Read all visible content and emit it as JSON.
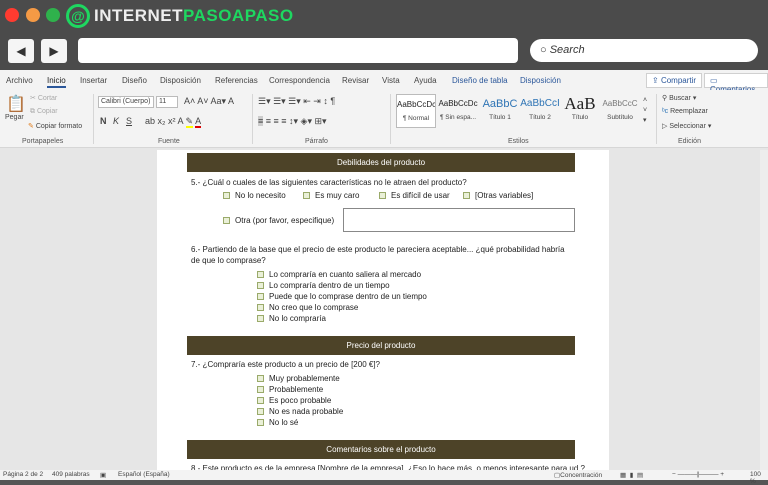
{
  "browser": {
    "logo_left": "INTERNET",
    "logo_right": "PASOAPASO",
    "lights": [
      "#ff3b30",
      "#f59a45",
      "#2fb24c"
    ],
    "back_icon": "◀",
    "forward_icon": "▶",
    "address_value": "",
    "search_placeholder": "Search"
  },
  "ribbon": {
    "tabs": [
      "Archivo",
      "Inicio",
      "Insertar",
      "Diseño",
      "Disposición",
      "Referencias",
      "Correspondencia",
      "Revisar",
      "Vista",
      "Ayuda",
      "Diseño de tabla",
      "Disposición"
    ],
    "active_tab": "Inicio",
    "share": "Compartir",
    "comments": "Comentarios",
    "clipboard": {
      "paste": "Pegar",
      "cut": "Cortar",
      "copy": "Copiar",
      "format_painter": "Copiar formato",
      "label": "Portapapeles"
    },
    "font": {
      "name": "Calibri (Cuerpo)",
      "size": "11",
      "bold": "N",
      "italic": "K",
      "underline": "S",
      "label": "Fuente"
    },
    "paragraph": {
      "label": "Párrafo"
    },
    "styles": {
      "items": [
        {
          "sample": "AaBbCcDc",
          "name": "¶ Normal"
        },
        {
          "sample": "AaBbCcDc",
          "name": "¶ Sin espa..."
        },
        {
          "sample": "AaBbC",
          "name": "Título 1"
        },
        {
          "sample": "AaBbCcI",
          "name": "Título 2"
        },
        {
          "sample": "AaB",
          "name": "Título"
        },
        {
          "sample": "AaBbCcC",
          "name": "Subtítulo"
        }
      ],
      "label": "Estilos"
    },
    "editing": {
      "find": "Buscar",
      "replace": "Reemplazar",
      "select": "Seleccionar",
      "label": "Edición"
    }
  },
  "document": {
    "section1": "Debilidades del producto",
    "q5": "5.- ¿Cuál o cuales de las siguientes características no le atraen del producto?",
    "q5_options": [
      "No lo necesito",
      "Es muy caro",
      "Es difícil de usar",
      "[Otras variables]"
    ],
    "q5_other": "Otra (por favor, especifique)",
    "q6": "6.- Partiendo de la base que el precio de este producto le pareciera aceptable... ¿qué probabilidad habría de que lo comprase?",
    "q6_options": [
      "Lo compraría en cuanto saliera al mercado",
      "Lo compraría dentro de un tiempo",
      "Puede que lo comprase dentro de un tiempo",
      "No creo que lo comprase",
      "No lo compraría"
    ],
    "section2": "Precio del producto",
    "q7": "7.- ¿Compraría este producto a un precio de [200 €]?",
    "q7_options": [
      "Muy probablemente",
      "Probablemente",
      "Es poco probable",
      "No es nada probable",
      "No lo sé"
    ],
    "section3": "Comentarios sobre el producto",
    "q8": "8.- Este producto es de la empresa [Nombre de la empresa]. ¿Eso lo hace más, o menos interesante para ud.?"
  },
  "status": {
    "page": "Página 2 de 2",
    "words": "409 palabras",
    "language": "Español (España)",
    "focus": "Concentración",
    "zoom": "100 %",
    "zoom_percent": 100
  }
}
